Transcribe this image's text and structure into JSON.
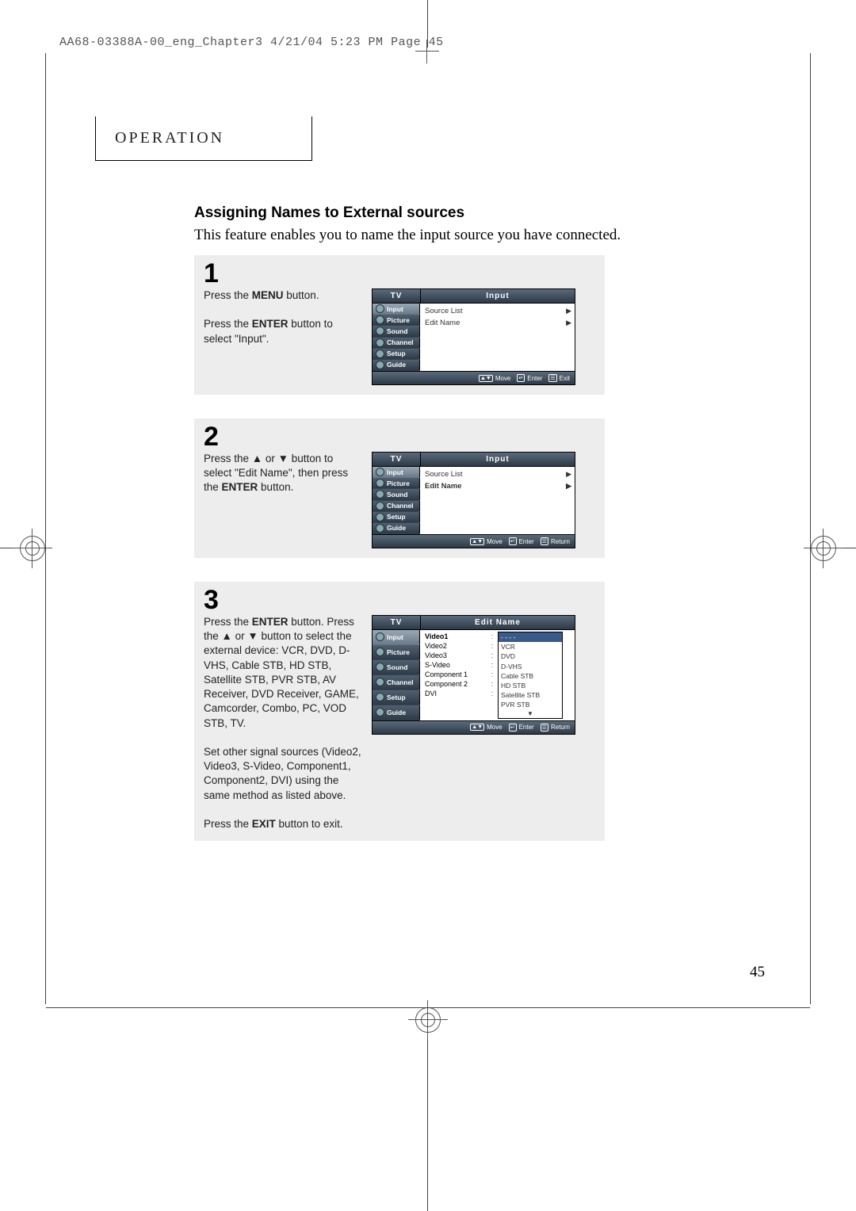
{
  "header_line": "AA68-03388A-00_eng_Chapter3  4/21/04  5:23 PM  Page 45",
  "operation_title": "OPERATION",
  "section_title": "Assigning Names to External sources",
  "section_sub": "This feature enables you to name the input source you have connected.",
  "page_number": "45",
  "osd_side_items": [
    "Input",
    "Picture",
    "Sound",
    "Channel",
    "Setup",
    "Guide"
  ],
  "step1": {
    "num": "1",
    "text1a": "Press the ",
    "text1b": "MENU",
    "text1c": " button.",
    "text2a": "Press the ",
    "text2b": "ENTER",
    "text2c": " button to select \"Input\".",
    "osd_header_left": "TV",
    "osd_header_right": "Input",
    "rows": [
      {
        "label": "Source List",
        "sel": false
      },
      {
        "label": "Edit Name",
        "sel": false
      }
    ],
    "footer": [
      "Move",
      "Enter",
      "Exit"
    ]
  },
  "step2": {
    "num": "2",
    "text1": "Press the ▲ or ▼ button to select \"Edit Name\", then press the ",
    "text1b": "ENTER",
    "text1c": " button.",
    "osd_header_left": "TV",
    "osd_header_right": "Input",
    "rows": [
      {
        "label": "Source List",
        "sel": false
      },
      {
        "label": "Edit Name",
        "sel": true
      }
    ],
    "footer": [
      "Move",
      "Enter",
      "Return"
    ]
  },
  "step3": {
    "num": "3",
    "p1a": "Press the ",
    "p1b": "ENTER",
    "p1c": " button. Press the ▲ or ▼ button to select the external device: VCR, DVD, D-VHS, Cable STB, HD STB, Satellite STB, PVR STB, AV Receiver, DVD Receiver, GAME, Camcorder, Combo, PC, VOD STB, TV.",
    "p2": "Set other signal sources (Video2, Video3, S-Video, Component1, Component2, DVI) using the same method as listed above.",
    "p3a": "Press the ",
    "p3b": "EXIT",
    "p3c": " button to exit.",
    "osd_header_left": "TV",
    "osd_header_right": "Edit Name",
    "col1": [
      "Video1",
      "Video2",
      "Video3",
      "S-Video",
      "Component 1",
      "Component 2",
      "DVI"
    ],
    "drop_top_sel": "- - - -",
    "drop": [
      "VCR",
      "DVD",
      "D-VHS",
      "Cable STB",
      "HD STB",
      "Satellite STB",
      "PVR STB"
    ],
    "footer": [
      "Move",
      "Enter",
      "Return"
    ]
  }
}
